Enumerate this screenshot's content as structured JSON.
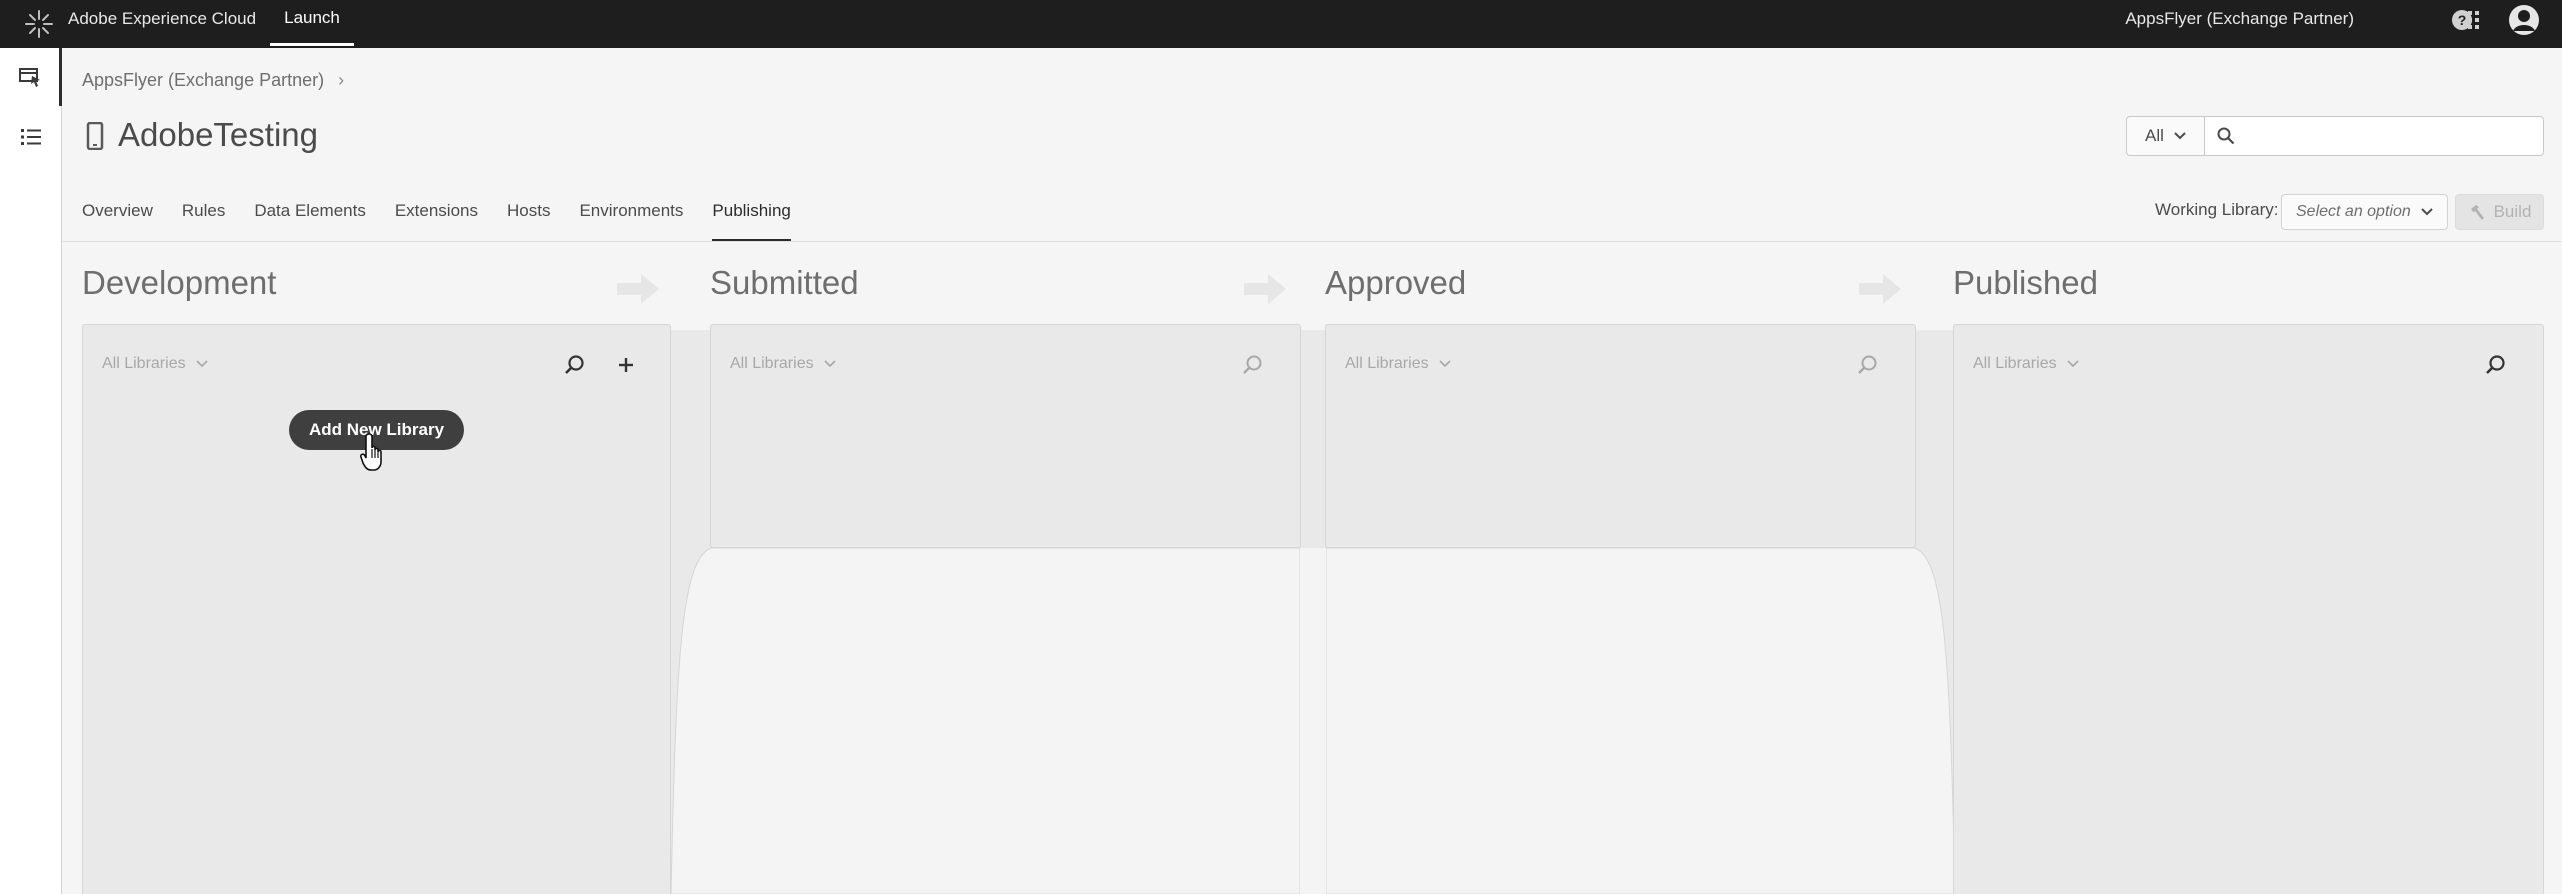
{
  "topbar": {
    "brand": "Adobe Experience Cloud",
    "product": "Launch",
    "org": "AppsFlyer (Exchange Partner)",
    "icons": [
      "adobe-logo-icon",
      "apps-grid-icon",
      "help-icon",
      "avatar-icon"
    ]
  },
  "rail": {
    "icons": [
      "property-monitor-icon",
      "list-icon"
    ]
  },
  "breadcrumb": {
    "org": "AppsFlyer (Exchange Partner)",
    "chevron": "›"
  },
  "property": {
    "title": "AdobeTesting",
    "icon": "mobile-device-icon"
  },
  "search": {
    "scope": "All",
    "placeholder": ""
  },
  "tabs": [
    {
      "label": "Overview"
    },
    {
      "label": "Rules"
    },
    {
      "label": "Data Elements"
    },
    {
      "label": "Extensions"
    },
    {
      "label": "Hosts"
    },
    {
      "label": "Environments"
    },
    {
      "label": "Publishing",
      "active": true
    }
  ],
  "working_library": {
    "label": "Working Library:",
    "placeholder": "Select an option",
    "build_label": "Build"
  },
  "columns": [
    {
      "title": "Development",
      "filter": "All Libraries"
    },
    {
      "title": "Submitted",
      "filter": "All Libraries"
    },
    {
      "title": "Approved",
      "filter": "All Libraries"
    },
    {
      "title": "Published",
      "filter": "All Libraries"
    }
  ],
  "add_library": {
    "label": "Add New Library"
  },
  "colors": {
    "topbar": "#1e1e1e",
    "background": "#f5f5f5",
    "panel": "#e9e9e9",
    "button_dark": "#3f3f3f"
  }
}
